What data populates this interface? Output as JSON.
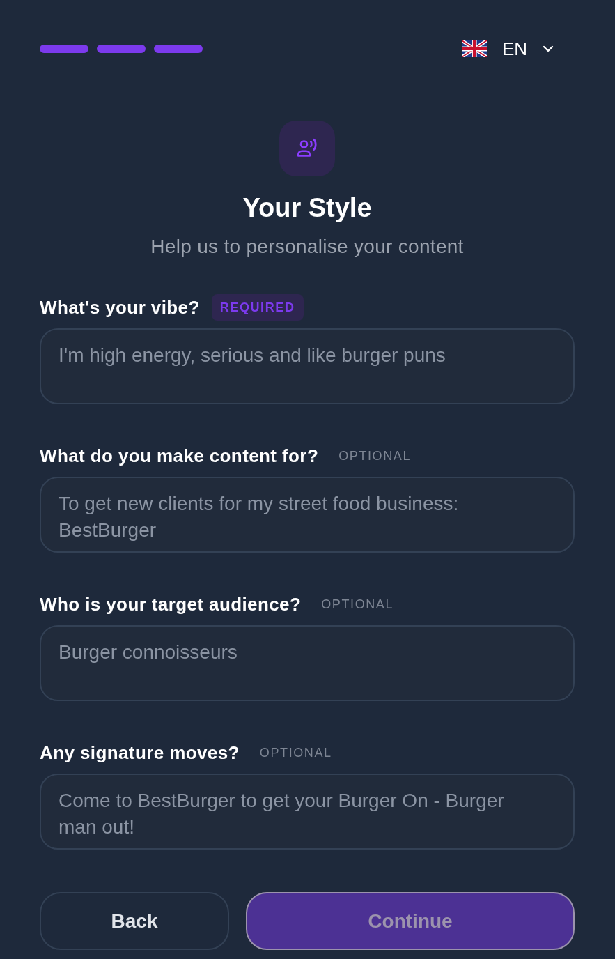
{
  "progress": {
    "steps": [
      {
        "done": true
      },
      {
        "done": true
      },
      {
        "done": true
      }
    ]
  },
  "language": {
    "code": "EN"
  },
  "header": {
    "title": "Your Style",
    "subtitle": "Help us to personalise your content"
  },
  "fields": [
    {
      "label": "What's your vibe?",
      "tag": "REQUIRED",
      "required": true,
      "placeholder": "I'm high energy, serious and like burger puns"
    },
    {
      "label": "What do you make content for?",
      "tag": "OPTIONAL",
      "required": false,
      "placeholder": "To get new clients for my street food business: BestBurger"
    },
    {
      "label": "Who is your target audience?",
      "tag": "OPTIONAL",
      "required": false,
      "placeholder": "Burger connoisseurs"
    },
    {
      "label": "Any signature moves?",
      "tag": "OPTIONAL",
      "required": false,
      "placeholder": "Come to BestBurger to get your Burger On - Burger man out!"
    }
  ],
  "buttons": [
    {
      "label": "Back",
      "kind": "secondary",
      "disabled": false
    },
    {
      "label": "Continue",
      "kind": "primary",
      "disabled": true
    }
  ]
}
